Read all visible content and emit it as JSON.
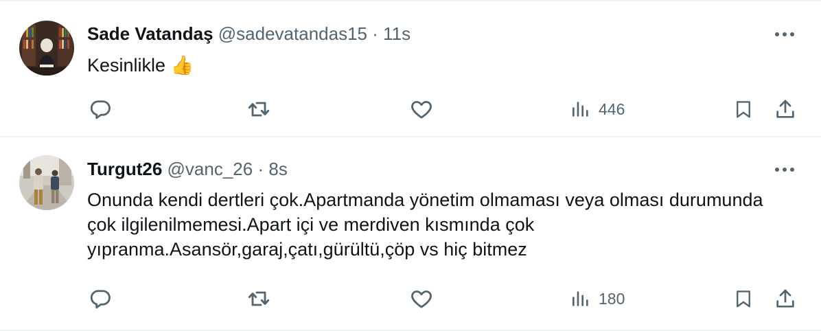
{
  "tweets": [
    {
      "author_name": "Sade Vatandaş",
      "handle": "@sadevatandas15",
      "separator": "·",
      "time": "11s",
      "text": "Kesinlikle",
      "emoji": "👍",
      "views": "446"
    },
    {
      "author_name": "Turgut26",
      "handle": "@vanc_26",
      "separator": "·",
      "time": "8s",
      "text": "Onunda kendi dertleri çok.Apartmanda yönetim olmaması veya olması durumunda çok ilgilenilmemesi.Apart içi ve merdiven kısmında çok yıpranma.Asansör,garaj,çatı,gürültü,çöp vs hiç bitmez",
      "views": "180"
    }
  ],
  "icons": {
    "reply": "reply-icon",
    "retweet": "retweet-icon",
    "like": "heart-icon",
    "views": "views-icon",
    "bookmark": "bookmark-icon",
    "share": "share-icon",
    "more": "more-icon"
  },
  "colors": {
    "text_primary": "#0f1419",
    "text_secondary": "#536471",
    "divider": "#eff3f4"
  }
}
